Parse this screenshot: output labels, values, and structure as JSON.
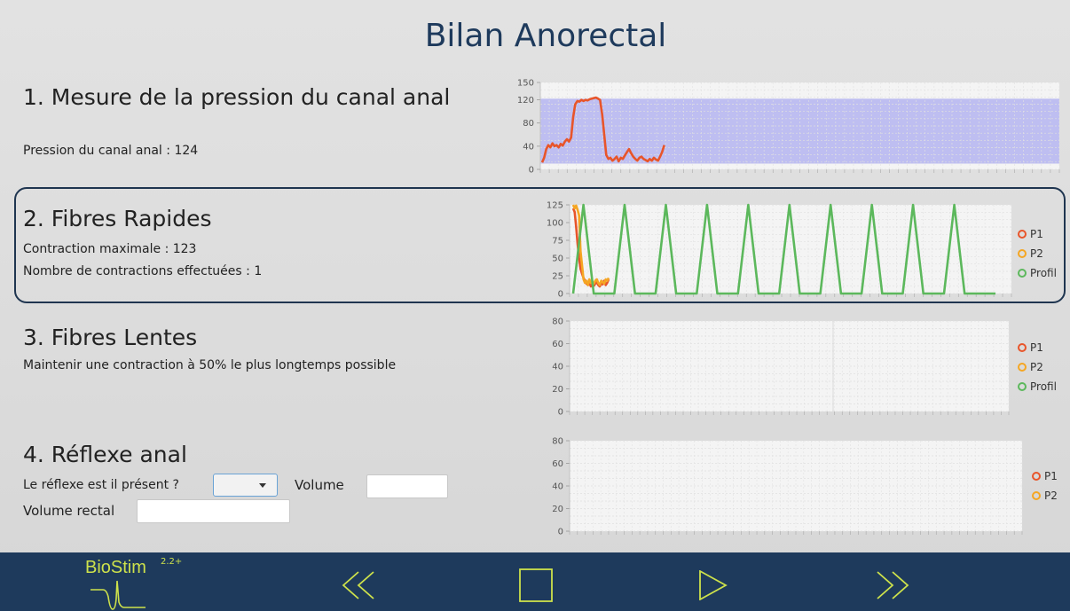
{
  "page_title": "Bilan Anorectal",
  "colors": {
    "footer_bg": "#1e3a5c",
    "accent": "#cde14b",
    "p1": "#e8552a",
    "p2": "#f5a623",
    "profil": "#5cb85c",
    "target_band": "#b4b4f0"
  },
  "sections": {
    "anal_pressure": {
      "title": "1. Mesure de la pression du canal anal",
      "pressure_label": "Pression du canal anal : 124"
    },
    "fast_fibers": {
      "title": "2. Fibres Rapides",
      "max_contraction": "Contraction maximale : 123",
      "contraction_count": "Nombre de contractions effectuées : 1"
    },
    "slow_fibers": {
      "title": "3. Fibres Lentes",
      "instruction": "Maintenir une contraction à 50% le plus longtemps possible"
    },
    "anal_reflex": {
      "title": "4. Réflexe anal",
      "reflex_question": "Le réflexe est il présent ?",
      "reflex_select_value": "",
      "volume_label": "Volume",
      "volume_value": "",
      "rectal_volume_label": "Volume rectal",
      "rectal_volume_value": ""
    }
  },
  "chart_data": [
    {
      "type": "line",
      "ylim": [
        0,
        150
      ],
      "yticks": [
        "150",
        "120",
        "80",
        "40",
        "0"
      ],
      "target_band": [
        10,
        122
      ],
      "series": [
        {
          "x": [
            0,
            1,
            2,
            3,
            4,
            5,
            6,
            7,
            8,
            9,
            10,
            11,
            12,
            13,
            14,
            15,
            16,
            17,
            18,
            19,
            20,
            21,
            22,
            23,
            24,
            25,
            26,
            27,
            28,
            29,
            30,
            31,
            32,
            33,
            34,
            35,
            36,
            37,
            38,
            39,
            40,
            41,
            42,
            43,
            44,
            45,
            46,
            47,
            48,
            49,
            50,
            51,
            52,
            53,
            54,
            55,
            56,
            57,
            58,
            59
          ],
          "values": [
            12,
            20,
            35,
            42,
            38,
            45,
            40,
            42,
            38,
            44,
            41,
            48,
            52,
            48,
            55,
            90,
            112,
            118,
            117,
            120,
            118,
            120,
            119,
            121,
            122,
            123,
            124,
            122,
            120,
            95,
            60,
            25,
            18,
            20,
            15,
            18,
            22,
            14,
            20,
            18,
            24,
            30,
            35,
            28,
            22,
            18,
            15,
            20,
            22,
            18,
            16,
            14,
            18,
            15,
            20,
            17,
            15,
            22,
            30,
            42
          ]
        }
      ]
    },
    {
      "type": "line",
      "ylim": [
        0,
        125
      ],
      "yticks": [
        "125",
        "100",
        "75",
        "50",
        "25",
        "0"
      ],
      "legend": [
        "P1",
        "P2",
        "Profil"
      ],
      "series": [
        {
          "name": "P1",
          "x": [
            0,
            1,
            2,
            3,
            4,
            5,
            6,
            7,
            8,
            9,
            10,
            11,
            12,
            13,
            14,
            15,
            16,
            17,
            18,
            19,
            20,
            21,
            22,
            23,
            24
          ],
          "values": [
            120,
            115,
            95,
            70,
            50,
            35,
            28,
            22,
            18,
            14,
            12,
            15,
            10,
            13,
            11,
            14,
            16,
            12,
            10,
            14,
            13,
            18,
            12,
            15,
            20
          ]
        },
        {
          "name": "P2",
          "x": [
            0,
            1,
            2,
            3,
            4,
            5,
            6,
            7,
            8,
            9,
            10,
            11,
            12,
            13,
            14,
            15,
            16,
            17,
            18,
            19,
            20,
            21,
            22,
            23,
            24
          ],
          "values": [
            125,
            120,
            124,
            118,
            110,
            60,
            40,
            20,
            15,
            18,
            12,
            20,
            15,
            16,
            14,
            18,
            20,
            15,
            12,
            18,
            16,
            14,
            20,
            18,
            22
          ]
        },
        {
          "name": "Profil",
          "x": [
            0,
            10,
            20,
            30,
            40,
            50,
            60,
            70,
            80,
            90,
            100,
            110,
            120,
            130,
            140,
            150,
            160,
            170,
            180,
            190,
            200,
            210,
            220,
            230,
            240,
            250,
            260,
            270,
            280,
            290,
            300,
            310,
            320,
            330,
            340,
            350,
            360,
            370,
            380,
            390,
            400,
            410
          ],
          "values": [
            0,
            125,
            0,
            0,
            0,
            125,
            0,
            0,
            0,
            125,
            0,
            0,
            0,
            125,
            0,
            0,
            0,
            125,
            0,
            0,
            0,
            125,
            0,
            0,
            0,
            125,
            0,
            0,
            0,
            125,
            0,
            0,
            0,
            125,
            0,
            0,
            0,
            125,
            0,
            0,
            0,
            0
          ]
        }
      ]
    },
    {
      "type": "line",
      "ylim": [
        0,
        80
      ],
      "yticks": [
        "80",
        "60",
        "40",
        "20",
        "0"
      ],
      "legend": [
        "P1",
        "P2",
        "Profil"
      ],
      "series": []
    },
    {
      "type": "line",
      "ylim": [
        0,
        80
      ],
      "yticks": [
        "80",
        "60",
        "40",
        "20",
        "0"
      ],
      "legend": [
        "P1",
        "P2"
      ],
      "series": []
    }
  ],
  "footer": {
    "logo_text": "BioStim",
    "logo_version": "2.2+",
    "controls": {
      "rewind": "rewind-icon",
      "stop": "stop-icon",
      "play": "play-icon",
      "forward": "fast-forward-icon"
    }
  }
}
